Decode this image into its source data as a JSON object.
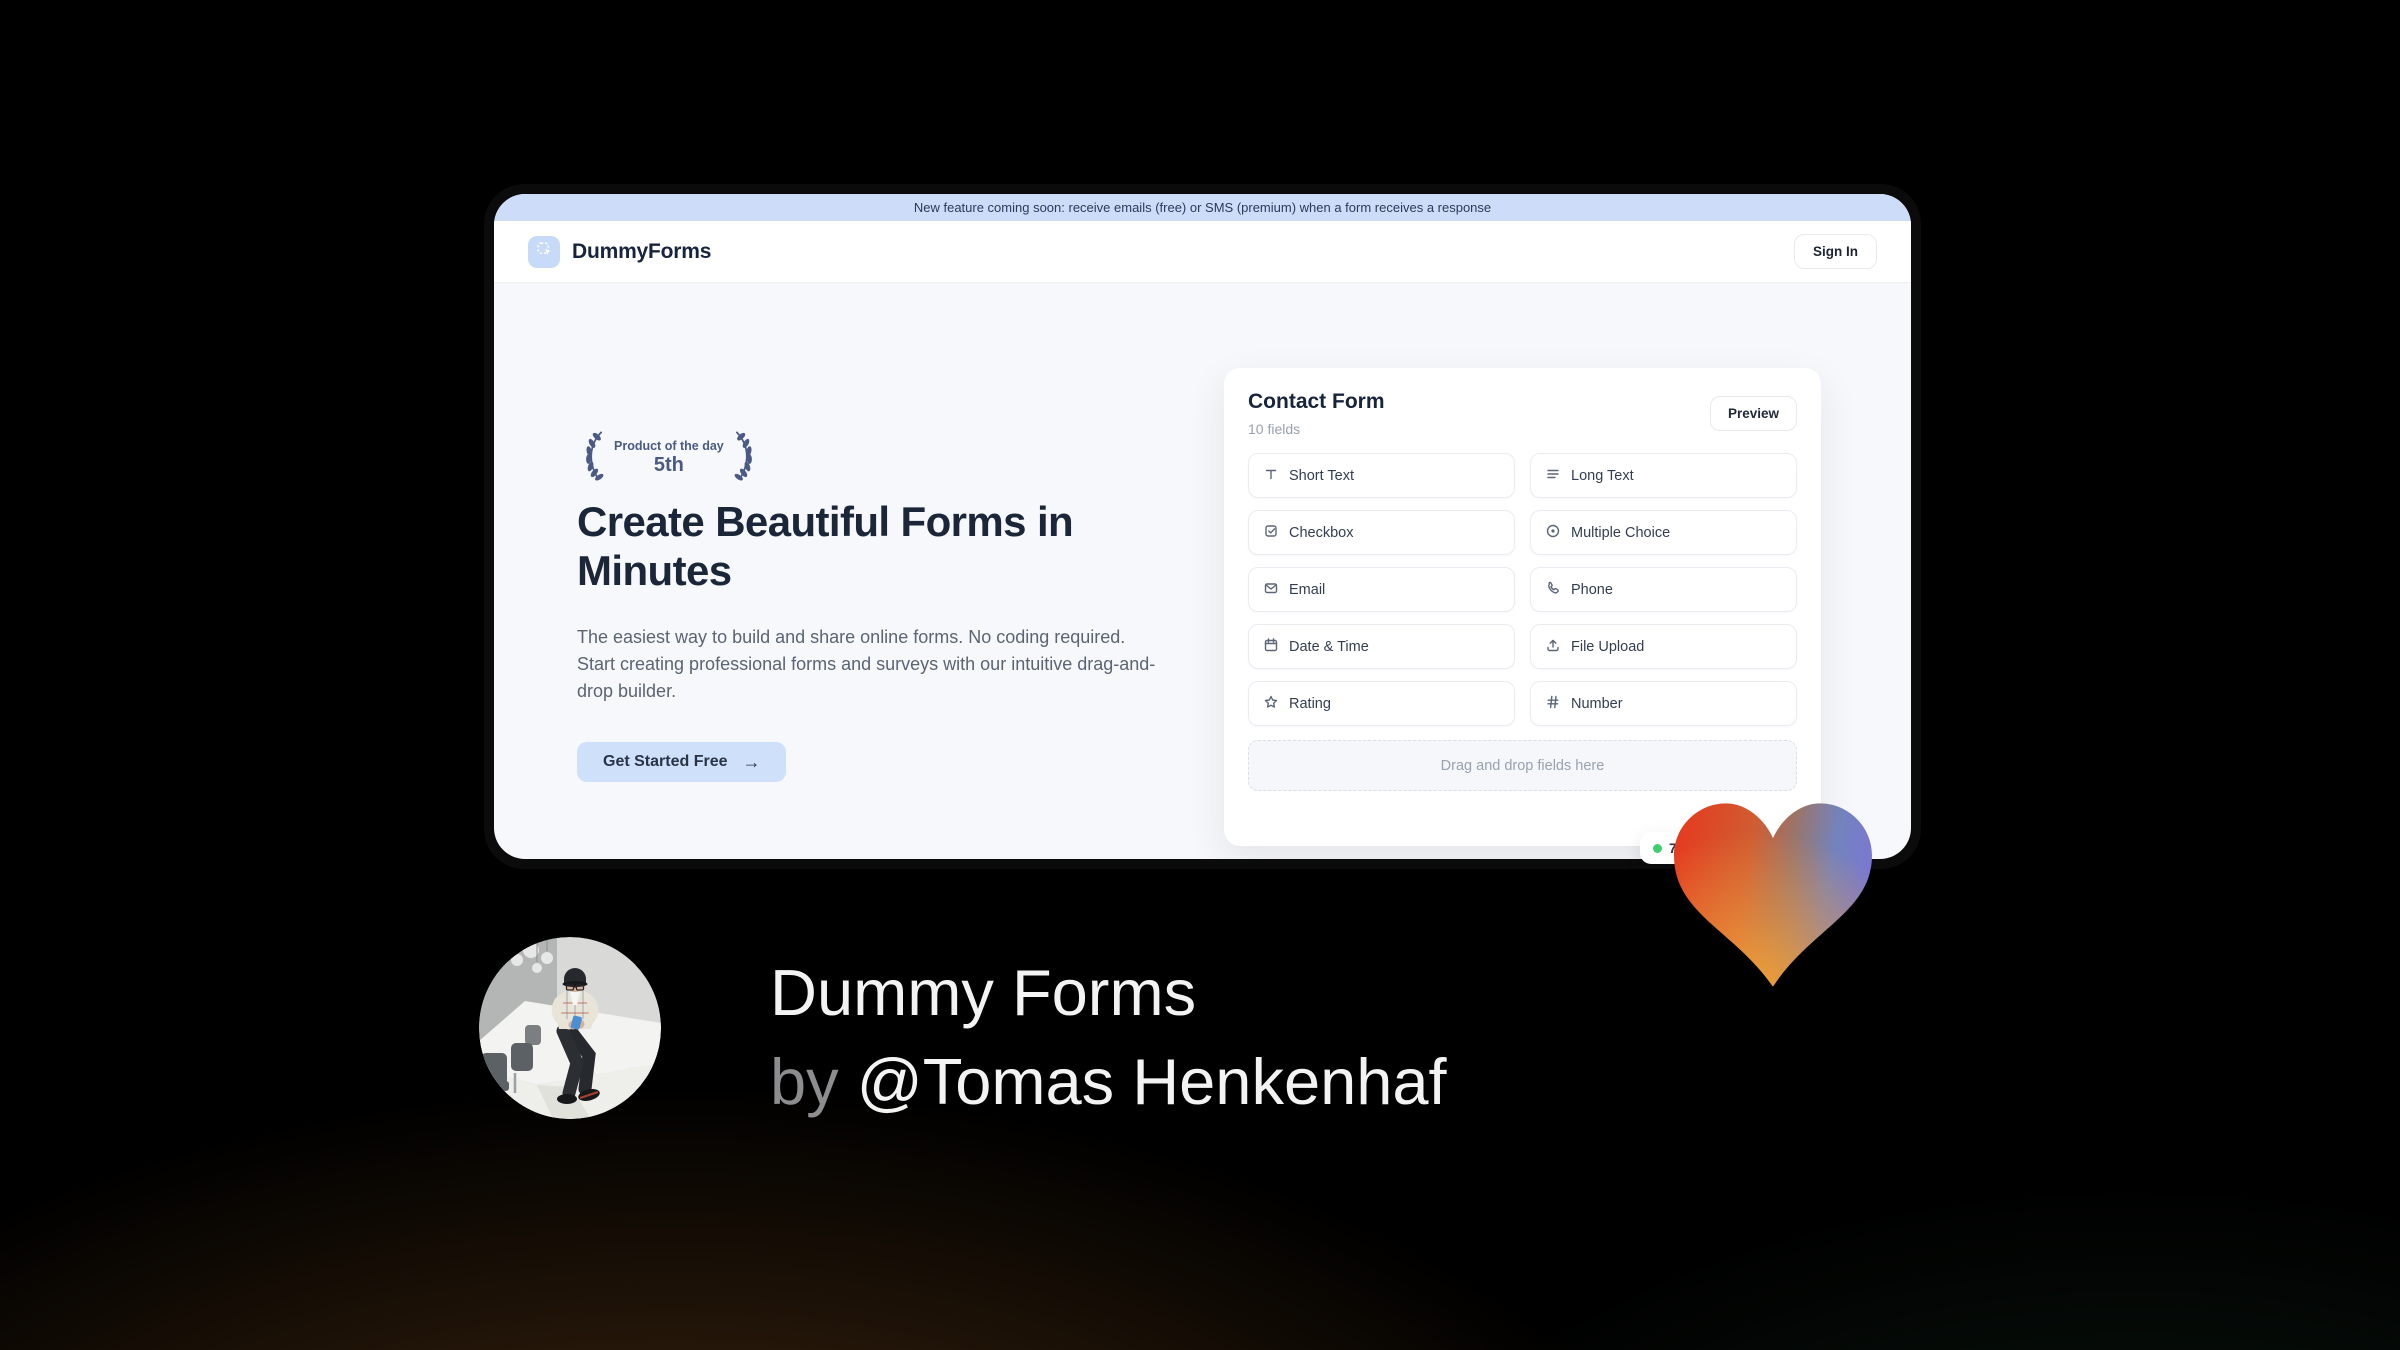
{
  "banner": {
    "text": "New feature coming soon: receive emails (free) or SMS (premium) when a form receives a response"
  },
  "navbar": {
    "brand": "DummyForms",
    "logo_icon": "dashed-select-cursor-icon",
    "sign_in_label": "Sign In"
  },
  "hero": {
    "badge": {
      "label": "Product of the day",
      "rank": "5th",
      "icon": "laurel-wreath-icon"
    },
    "heading": "Create Beautiful Forms in Minutes",
    "description": "The easiest way to build and share online forms. No coding required. Start creating professional forms and surveys with our intuitive drag-and-drop builder.",
    "cta_label": "Get Started Free",
    "cta_arrow": "→"
  },
  "form_builder": {
    "title": "Contact Form",
    "subtitle": "10 fields",
    "preview_label": "Preview",
    "fields": [
      {
        "label": "Short Text",
        "icon": "text-icon"
      },
      {
        "label": "Long Text",
        "icon": "lines-icon"
      },
      {
        "label": "Checkbox",
        "icon": "checkbox-icon"
      },
      {
        "label": "Multiple Choice",
        "icon": "radio-icon"
      },
      {
        "label": "Email",
        "icon": "envelope-icon"
      },
      {
        "label": "Phone",
        "icon": "phone-icon"
      },
      {
        "label": "Date & Time",
        "icon": "calendar-icon"
      },
      {
        "label": "File Upload",
        "icon": "upload-icon"
      },
      {
        "label": "Rating",
        "icon": "star-icon"
      },
      {
        "label": "Number",
        "icon": "hash-icon"
      }
    ],
    "dropzone_text": "Drag and drop fields here",
    "response_badge": {
      "text": "77",
      "dot_color": "#3fce6f"
    }
  },
  "credit": {
    "title": "Dummy Forms",
    "byline_prefix": "by ",
    "byline_handle": "@Tomas Henkenhaf"
  },
  "colors": {
    "banner_bg": "#cdddf9",
    "accent_blue": "#cfe0fa",
    "brand_navy": "#17243c",
    "laurel": "#4a5a85",
    "green_dot": "#3fce6f",
    "heart_red": "#e63a1f",
    "heart_orange": "#f3a233",
    "heart_purple": "#7a78d1"
  }
}
